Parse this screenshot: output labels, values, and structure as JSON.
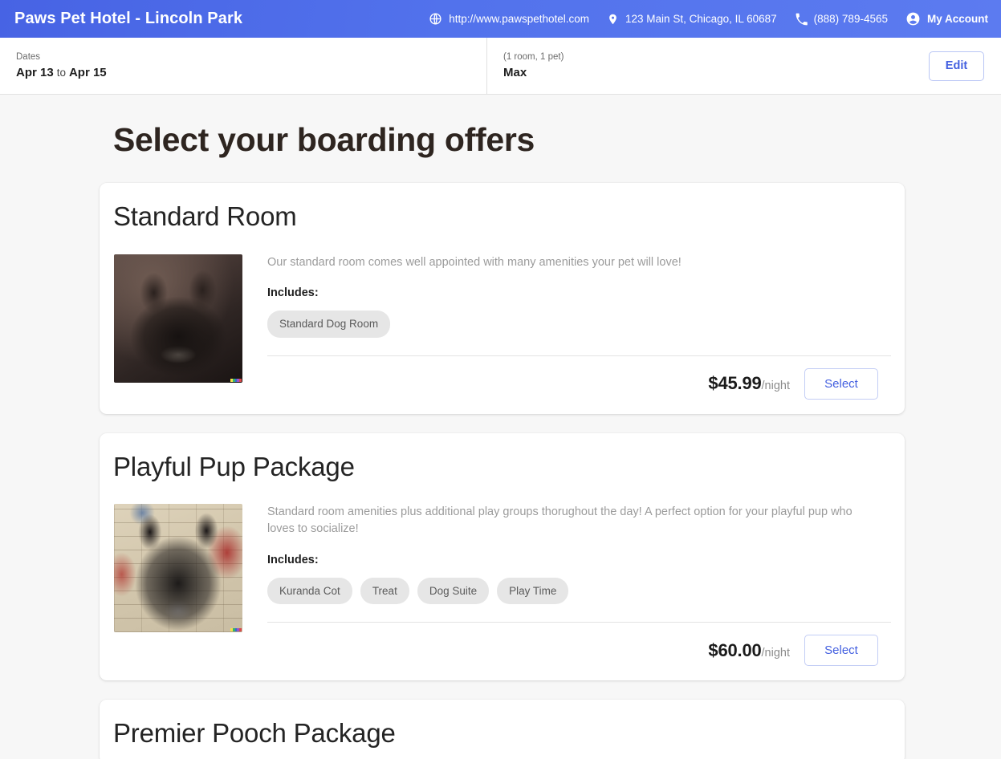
{
  "header": {
    "brand": "Paws Pet Hotel - Lincoln Park",
    "website": "http://www.pawspethotel.com",
    "address": "123 Main St, Chicago, IL 60687",
    "phone": "(888) 789-4565",
    "account": "My Account",
    "icons": {
      "website": "globe-icon",
      "address": "location-pin-icon",
      "phone": "phone-icon",
      "account": "account-circle-icon"
    },
    "background_color": "#5272ec"
  },
  "booking_bar": {
    "dates_label": "Dates",
    "date_start": "Apr 13",
    "date_separator": "to",
    "date_end": "Apr 15",
    "occupancy": "(1 room, 1 pet)",
    "pet_name": "Max",
    "edit_label": "Edit",
    "accent_color": "#4460e0"
  },
  "main": {
    "page_title": "Select your boarding offers",
    "includes_label": "Includes:",
    "per_night_suffix": "/night",
    "select_label": "Select",
    "offers": [
      {
        "title": "Standard Room",
        "description": "Our standard room comes well appointed with many amenities your pet will love!",
        "chips": [
          "Standard Dog Room"
        ],
        "price": "$45.99",
        "image_alt": "dark-french-bulldog-portrait"
      },
      {
        "title": "Playful Pup Package",
        "description": "Standard room amenities plus additional play groups thorughout the day! A perfect option for your playful pup who loves to socialize!",
        "chips": [
          "Kuranda Cot",
          "Treat",
          "Dog Suite",
          "Play Time"
        ],
        "price": "$60.00",
        "image_alt": "french-bulldog-against-painted-brick-wall"
      },
      {
        "title": "Premier Pooch Package",
        "description": "",
        "chips": [],
        "price": "",
        "image_alt": ""
      }
    ]
  }
}
